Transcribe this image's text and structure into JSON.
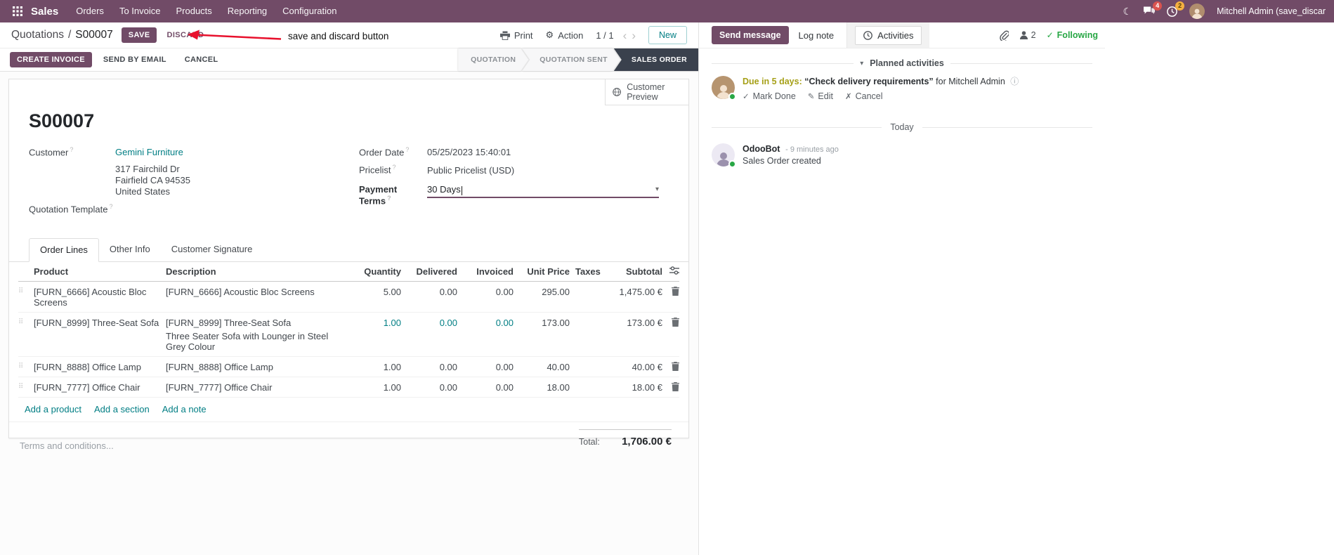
{
  "colors": {
    "primary": "#714B67",
    "link": "#017e84",
    "highlight": "#017e84",
    "arrow": "#e8112d",
    "state-active": "#3a414d",
    "badge-red": "#d9534f",
    "badge-orange": "#f5b041",
    "success": "#28a745",
    "due": "#a6a018"
  },
  "icons": {
    "moon": "☾",
    "gear": "⚙",
    "prev": "‹",
    "next": "›",
    "caret": "▾",
    "handle": "⠿",
    "info": "ⓘ",
    "check": "✓",
    "pencil": "✎",
    "x": "✗",
    "help": "?",
    "sep": "/"
  },
  "app": {
    "brand": "Sales",
    "menus": [
      "Orders",
      "To Invoice",
      "Products",
      "Reporting",
      "Configuration"
    ],
    "badges": {
      "messages": "4",
      "activities": "2"
    },
    "user": "Mitchell Admin (save_discar"
  },
  "cp": {
    "parent": "Quotations",
    "current": "S00007",
    "save": "SAVE",
    "discard": "DISCARD",
    "print": "Print",
    "action": "Action",
    "pager": "1 / 1",
    "new": "New"
  },
  "annotation": {
    "text": "save and discard button"
  },
  "status": {
    "create_invoice": "CREATE INVOICE",
    "send_by_email": "SEND BY EMAIL",
    "cancel": "CANCEL",
    "states": [
      {
        "label": "QUOTATION",
        "active": false
      },
      {
        "label": "QUOTATION SENT",
        "active": false
      },
      {
        "label": "SALES ORDER",
        "active": true
      }
    ]
  },
  "sheet": {
    "preview": "Customer Preview",
    "name": "S00007",
    "customer_label": "Customer",
    "customer_value": "Gemini Furniture",
    "address": [
      "317 Fairchild Dr",
      "Fairfield CA 94535",
      "United States"
    ],
    "template_label": "Quotation Template",
    "order_date_label": "Order Date",
    "order_date_value": "05/25/2023 15:40:01",
    "pricelist_label": "Pricelist",
    "pricelist_value": "Public Pricelist (USD)",
    "payment_terms_label": "Payment Terms",
    "payment_terms_value": "30 Days"
  },
  "tabs": [
    "Order Lines",
    "Other Info",
    "Customer Signature"
  ],
  "lines": {
    "headers": [
      "Product",
      "Description",
      "Quantity",
      "Delivered",
      "Invoiced",
      "Unit Price",
      "Taxes",
      "Subtotal"
    ],
    "rows": [
      {
        "product": "[FURN_6666] Acoustic Bloc Screens",
        "desc1": "[FURN_6666] Acoustic Bloc Screens",
        "desc2": "",
        "qty": "5.00",
        "delivered": "0.00",
        "invoiced": "0.00",
        "unit_price": "295.00",
        "taxes": "",
        "subtotal": "1,475.00 €"
      },
      {
        "product": "[FURN_8999] Three-Seat Sofa",
        "desc1": "[FURN_8999] Three-Seat Sofa",
        "desc2": "Three Seater Sofa with Lounger in Steel Grey Colour",
        "qty": "1.00",
        "delivered": "0.00",
        "invoiced": "0.00",
        "unit_price": "173.00",
        "taxes": "",
        "subtotal": "173.00 €"
      },
      {
        "product": "[FURN_8888] Office Lamp",
        "desc1": "[FURN_8888] Office Lamp",
        "desc2": "",
        "qty": "1.00",
        "delivered": "0.00",
        "invoiced": "0.00",
        "unit_price": "40.00",
        "taxes": "",
        "subtotal": "40.00 €"
      },
      {
        "product": "[FURN_7777] Office Chair",
        "desc1": "[FURN_7777] Office Chair",
        "desc2": "",
        "qty": "1.00",
        "delivered": "0.00",
        "invoiced": "0.00",
        "unit_price": "18.00",
        "taxes": "",
        "subtotal": "18.00 €"
      }
    ],
    "links": [
      "Add a product",
      "Add a section",
      "Add a note"
    ],
    "terms_placeholder": "Terms and conditions...",
    "total_label": "Total:",
    "total_value": "1,706.00 €"
  },
  "chatter": {
    "send_message": "Send message",
    "log_note": "Log note",
    "activities": "Activities",
    "followers_count": "2",
    "following": "Following",
    "planned_header": "Planned activities",
    "activity": {
      "due": "Due in 5 days:",
      "summary": "“Check delivery requirements”",
      "assignee": "for Mitchell Admin",
      "mark_done": "Mark Done",
      "edit": "Edit",
      "cancel": "Cancel"
    },
    "today": "Today",
    "message": {
      "author": "OdooBot",
      "time": "- 9 minutes ago",
      "body": "Sales Order created"
    }
  }
}
